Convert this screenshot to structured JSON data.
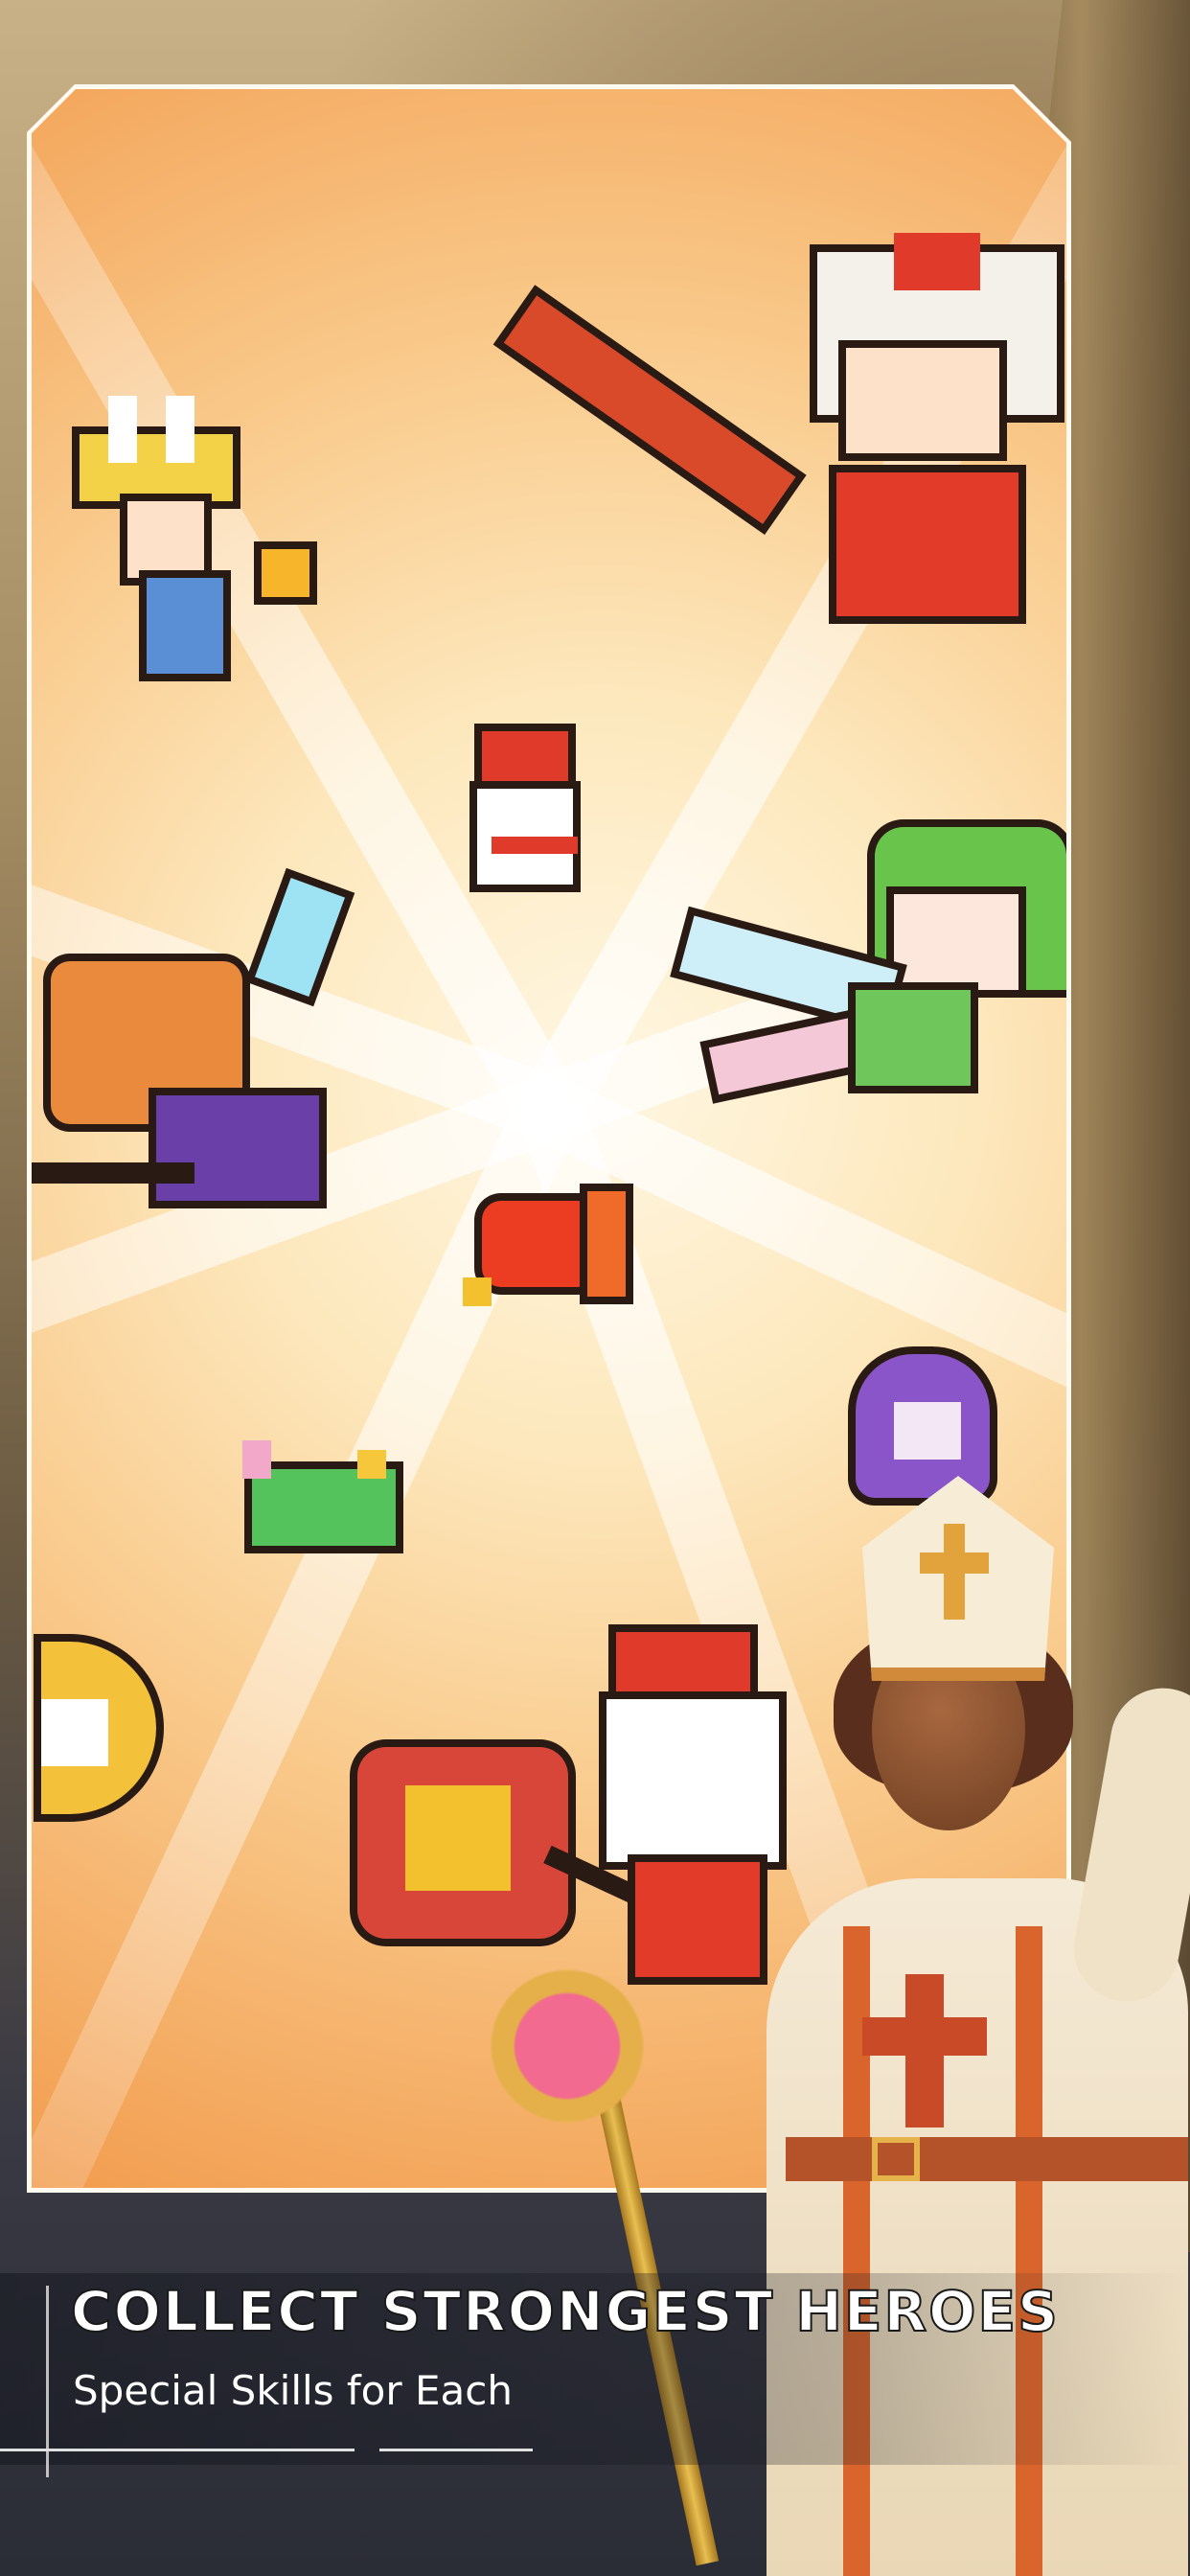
{
  "screen": {
    "headline": "COLLECT STRONGEST HEROES",
    "subheadline": "Special Skills for Each"
  },
  "art": {
    "heroes": [
      {
        "icon": "bunny-girl-sunflower-sprite"
      },
      {
        "icon": "lion-dance-hero-sprite"
      },
      {
        "icon": "snowman-sprite"
      },
      {
        "icon": "pumpkin-fairy-sprite"
      },
      {
        "icon": "frog-hood-angel-sprite"
      },
      {
        "icon": "goldfish-sprite"
      },
      {
        "icon": "purple-ghost-sprite"
      },
      {
        "icon": "unicorn-dragon-sprite"
      },
      {
        "icon": "moon-bunny-sprite"
      },
      {
        "icon": "santa-chicken-sprite"
      }
    ],
    "featured_hero": {
      "icon": "saint-priestess-illustration"
    }
  },
  "colors": {
    "background_warm": "#f9c98a",
    "accent_orange": "#f29c4e",
    "caption_text": "#ffffff"
  }
}
